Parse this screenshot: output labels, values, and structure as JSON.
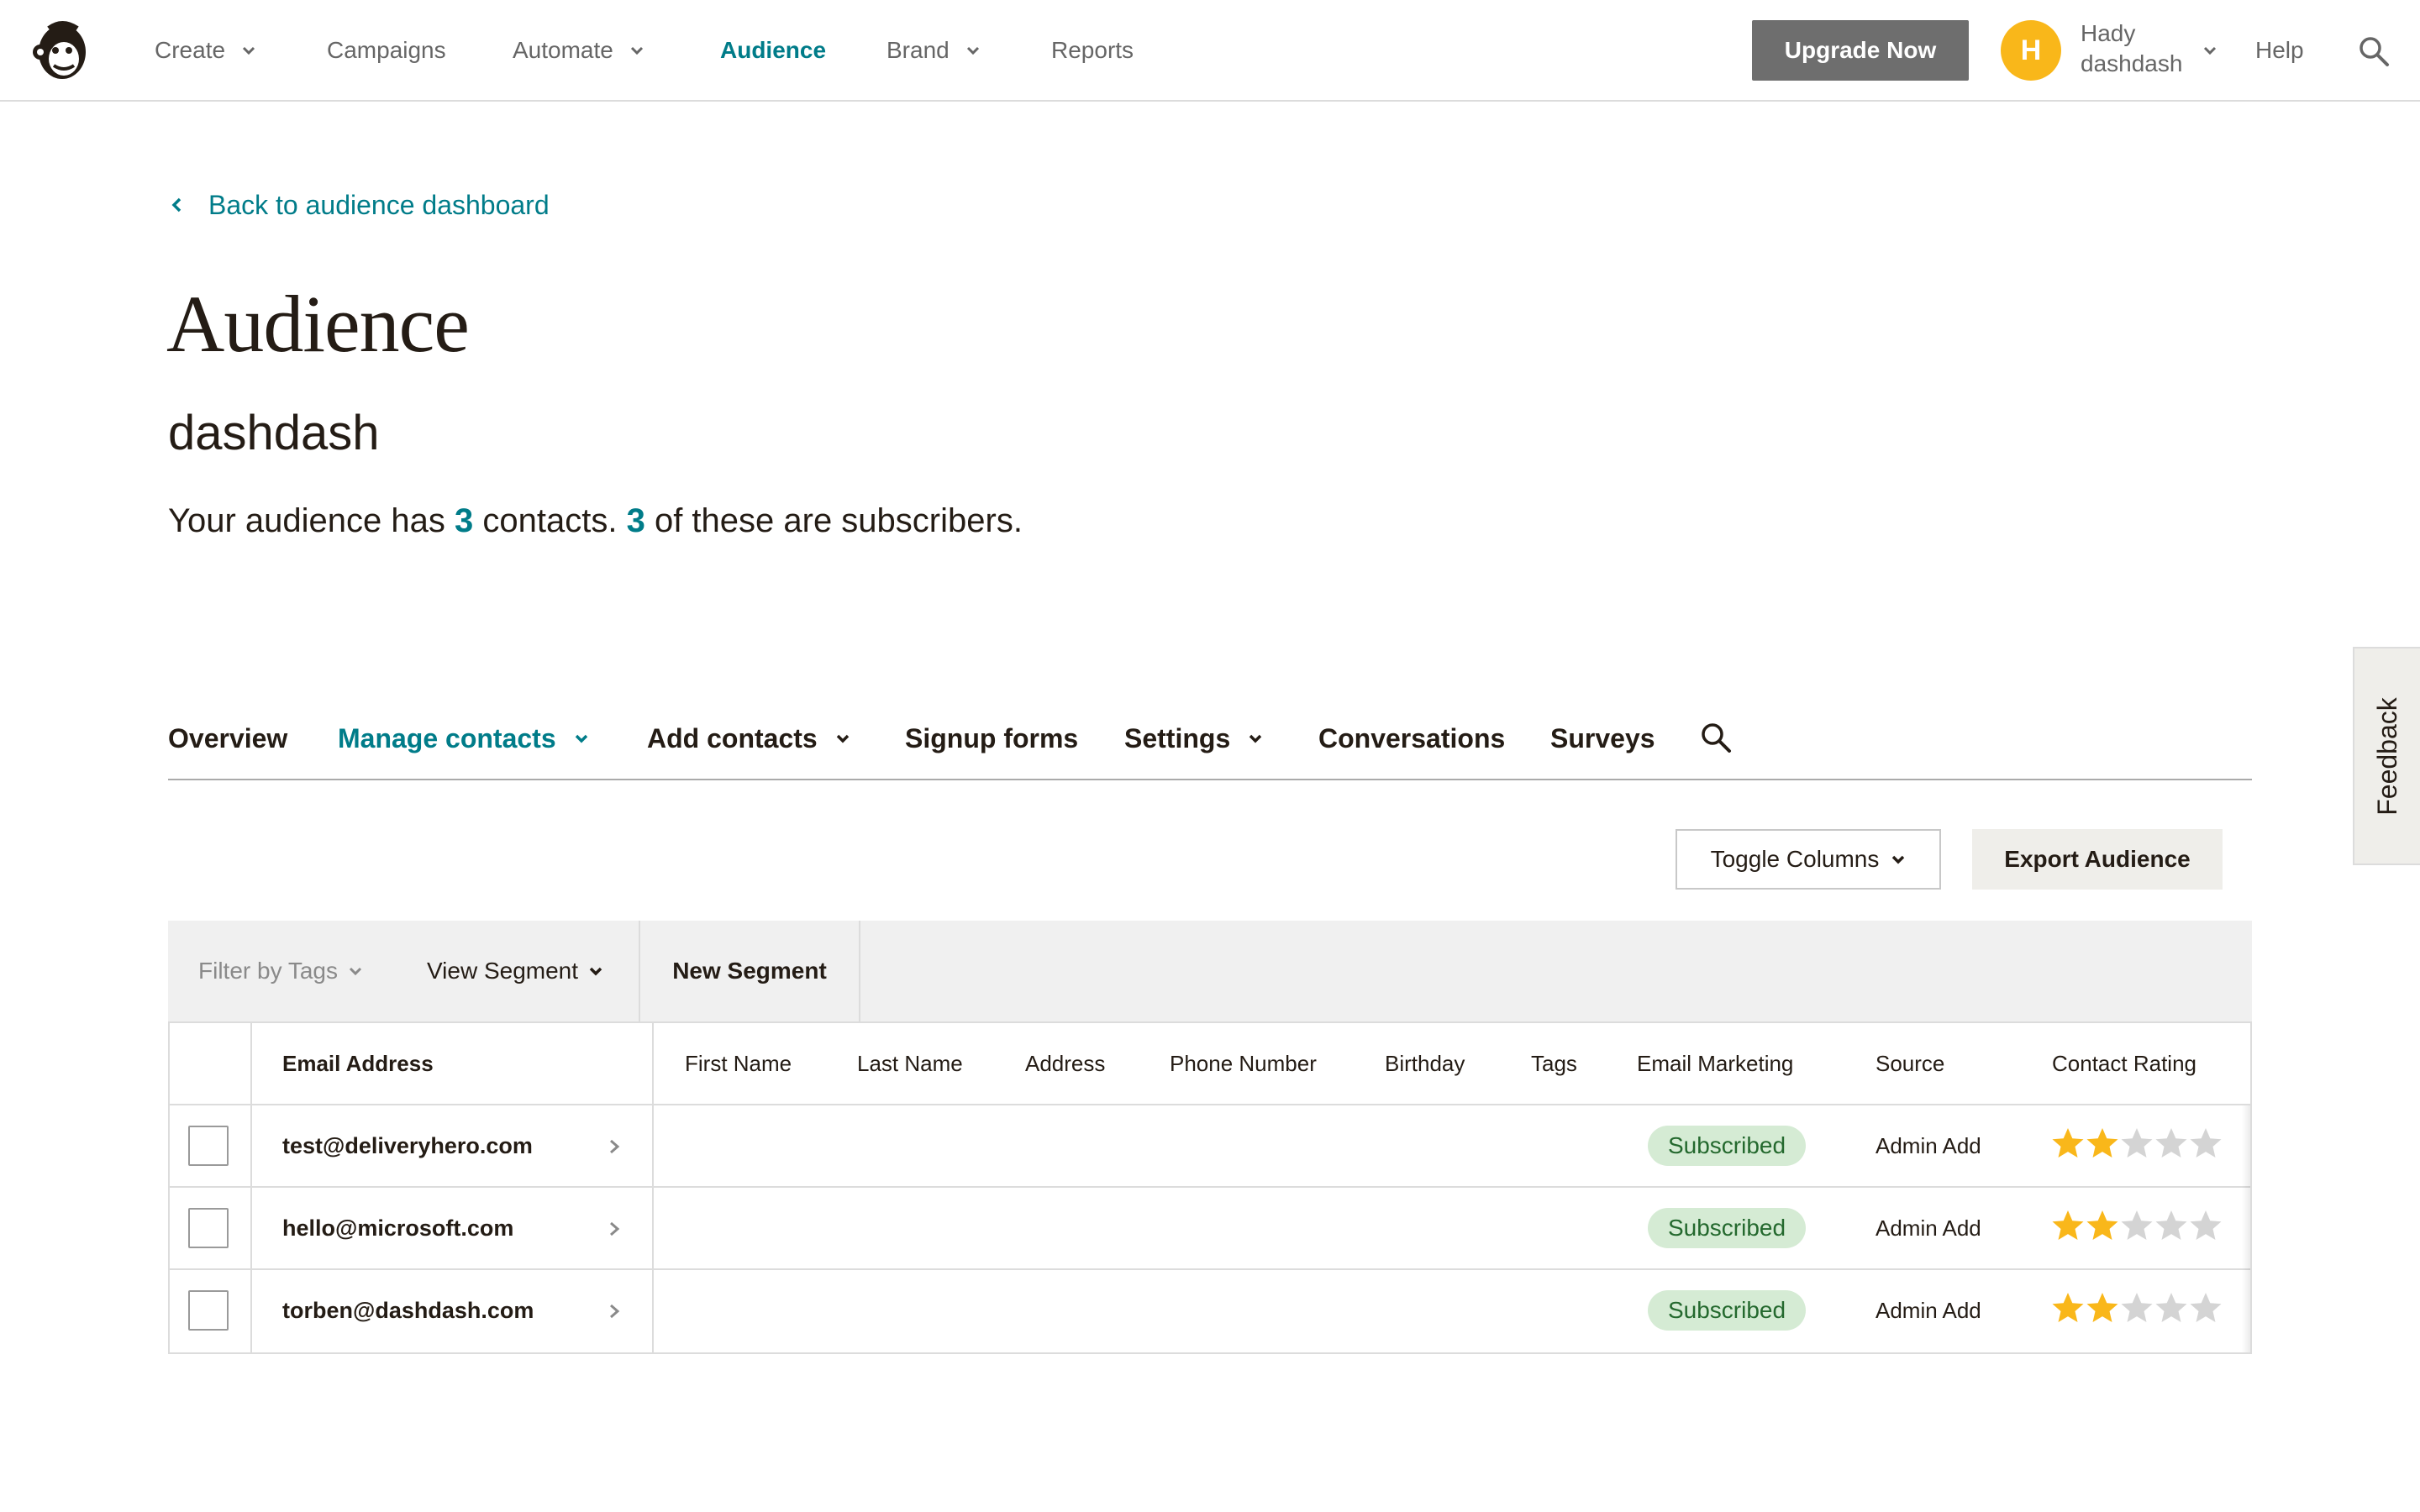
{
  "nav": {
    "items": [
      {
        "label": "Create",
        "dropdown": true
      },
      {
        "label": "Campaigns",
        "dropdown": false
      },
      {
        "label": "Automate",
        "dropdown": true
      },
      {
        "label": "Audience",
        "dropdown": false,
        "active": true
      },
      {
        "label": "Brand",
        "dropdown": true
      },
      {
        "label": "Reports",
        "dropdown": false
      }
    ],
    "upgrade_label": "Upgrade Now",
    "avatar_initial": "H",
    "user_first": "Hady",
    "user_second": "dashdash",
    "help_label": "Help"
  },
  "header": {
    "back_label": "Back to audience dashboard",
    "title": "Audience",
    "audience_name": "dashdash",
    "summary_prefix": "Your audience has ",
    "contacts_count": "3",
    "summary_middle": " contacts. ",
    "subscribers_count": "3",
    "summary_suffix": " of these are subscribers."
  },
  "subtabs": [
    {
      "label": "Overview",
      "dropdown": false
    },
    {
      "label": "Manage contacts",
      "dropdown": true,
      "active": true
    },
    {
      "label": "Add contacts",
      "dropdown": true
    },
    {
      "label": "Signup forms",
      "dropdown": false
    },
    {
      "label": "Settings",
      "dropdown": true
    },
    {
      "label": "Conversations",
      "dropdown": false
    },
    {
      "label": "Surveys",
      "dropdown": false
    }
  ],
  "actions": {
    "toggle_columns": "Toggle Columns",
    "export_audience": "Export Audience"
  },
  "filters": {
    "filter_by_tags": "Filter by Tags",
    "view_segment": "View Segment",
    "new_segment": "New Segment"
  },
  "table": {
    "columns": [
      "Email Address",
      "First Name",
      "Last Name",
      "Address",
      "Phone Number",
      "Birthday",
      "Tags",
      "Email Marketing",
      "Source",
      "Contact Rating"
    ],
    "rows": [
      {
        "email": "test@deliveryhero.com",
        "status": "Subscribed",
        "source": "Admin Add",
        "rating": 2,
        "rating_max": 5
      },
      {
        "email": "hello@microsoft.com",
        "status": "Subscribed",
        "source": "Admin Add",
        "rating": 2,
        "rating_max": 5
      },
      {
        "email": "torben@dashdash.com",
        "status": "Subscribed",
        "source": "Admin Add",
        "rating": 2,
        "rating_max": 5
      }
    ]
  },
  "feedback_label": "Feedback",
  "colors": {
    "accent": "#007c89",
    "upgrade_bg": "#6e6e6e",
    "avatar_bg": "#f9b71a",
    "badge_bg": "#d5ebd4",
    "badge_text": "#24692e",
    "star_filled": "#f9b71a",
    "star_empty": "#d4d4d4"
  },
  "icons": {
    "logo": "mailchimp-freddie-logo",
    "search": "search-icon",
    "chevron": "chevron-down-icon",
    "back": "chevron-left-icon",
    "row": "chevron-right-icon",
    "star": "star-icon"
  }
}
